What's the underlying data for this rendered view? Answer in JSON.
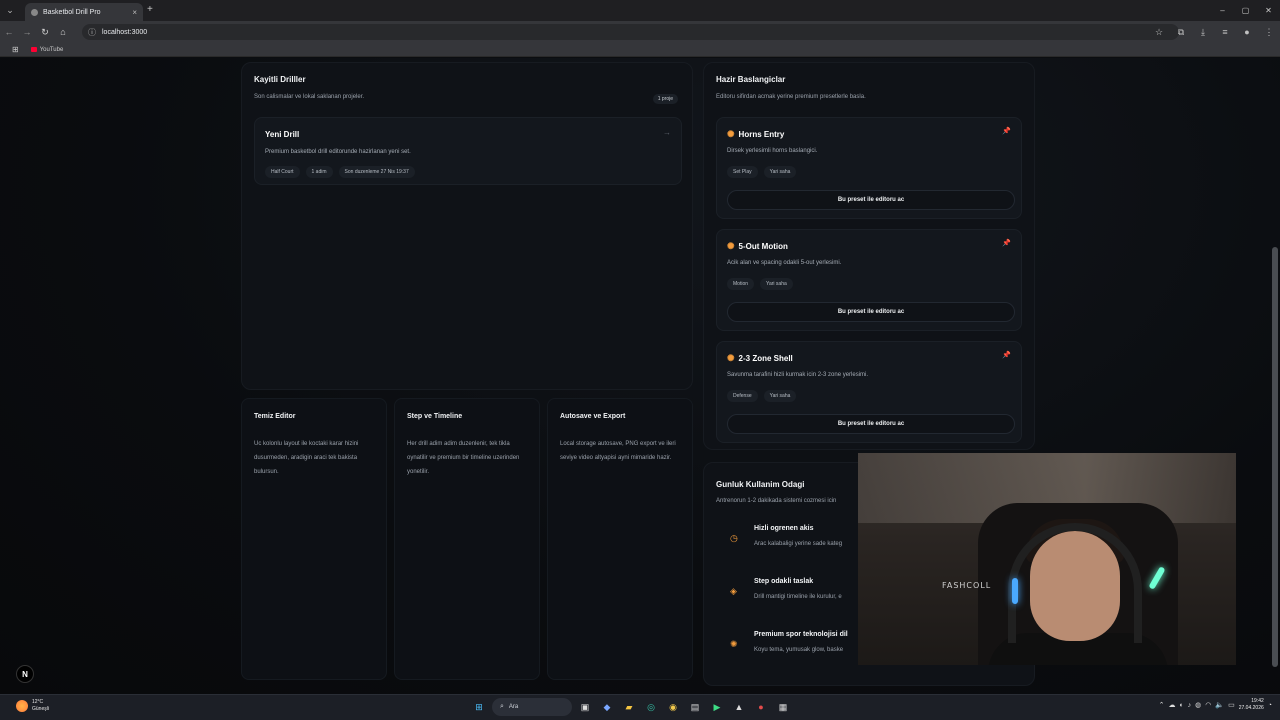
{
  "browser": {
    "tab_title": "Basketbol Drill Pro",
    "tab_close": "×",
    "new_tab": "+",
    "url": "localhost:3000",
    "bookmark_youtube": "YouTube",
    "window_minimize": "–",
    "window_restore": "▢",
    "window_close": "✕"
  },
  "saved_drills": {
    "title": "Kayitli Drilller",
    "subtitle": "Son calismalar ve lokal saklanan projeler.",
    "badge": "1 proje",
    "items": [
      {
        "name": "Yeni Drill",
        "description": "Premium basketbol drill editorunde hazirlanan yeni set.",
        "tags": [
          "Half Court",
          "1 adim",
          "Son duzenleme 27 Nis 19:37"
        ]
      }
    ]
  },
  "presets": {
    "title": "Hazir Baslangiclar",
    "subtitle": "Editoru sifirdan acmak yerine premium presetlerle basla.",
    "button_label": "Bu preset ile editoru ac",
    "items": [
      {
        "name": "Horns Entry",
        "description": "Dirsek yerlesimli horns baslangici.",
        "tags": [
          "Set Play",
          "Yari saha"
        ]
      },
      {
        "name": "5-Out Motion",
        "description": "Acik alan ve spacing odakli 5-out yerlesimi.",
        "tags": [
          "Motion",
          "Yari saha"
        ]
      },
      {
        "name": "2-3 Zone Shell",
        "description": "Savunma tarafini hizli kurmak icin 2-3 zone yerlesimi.",
        "tags": [
          "Defense",
          "Yari saha"
        ]
      }
    ]
  },
  "features": [
    {
      "title": "Temiz Editor",
      "description": "Uc kolonlu layout ile koctaki karar hizini dusurmeden, aradigin araci tek bakista bulursun."
    },
    {
      "title": "Step ve Timeline",
      "description": "Her drill adim adim duzenlenir, tek tikla oynatilir ve premium bir timeline uzerinden yonetilir."
    },
    {
      "title": "Autosave ve Export",
      "description": "Local storage autosave, PNG export ve ileri seviye video altyapisi ayni mimaride hazir."
    }
  ],
  "daily_focus": {
    "title": "Gunluk Kullanim Odagi",
    "subtitle": "Antrenorun 1-2 dakikada sistemi cozmesi icin",
    "items": [
      {
        "icon": "clock-icon",
        "title": "Hizli ogrenen akis",
        "description": "Arac kalabaligi yerine sade kateg"
      },
      {
        "icon": "layers-icon",
        "title": "Step odakli taslak",
        "description": "Drill mantigi timeline ile kurulur, e"
      },
      {
        "icon": "sparkle-icon",
        "title": "Premium spor teknolojisi dil",
        "description": "Koyu tema, yumusak glow, baske"
      }
    ]
  },
  "overlay": {
    "fab_label": "N",
    "webcam_text": "FASHCOLL"
  },
  "taskbar": {
    "temperature": "12°C",
    "weather": "Güneşli",
    "search_label": "Ara",
    "time": "19:42",
    "date": "27.04.2026"
  },
  "colors": {
    "accent": "#f39c3c",
    "background": "#0b0d10",
    "panel": "#0f1217"
  }
}
